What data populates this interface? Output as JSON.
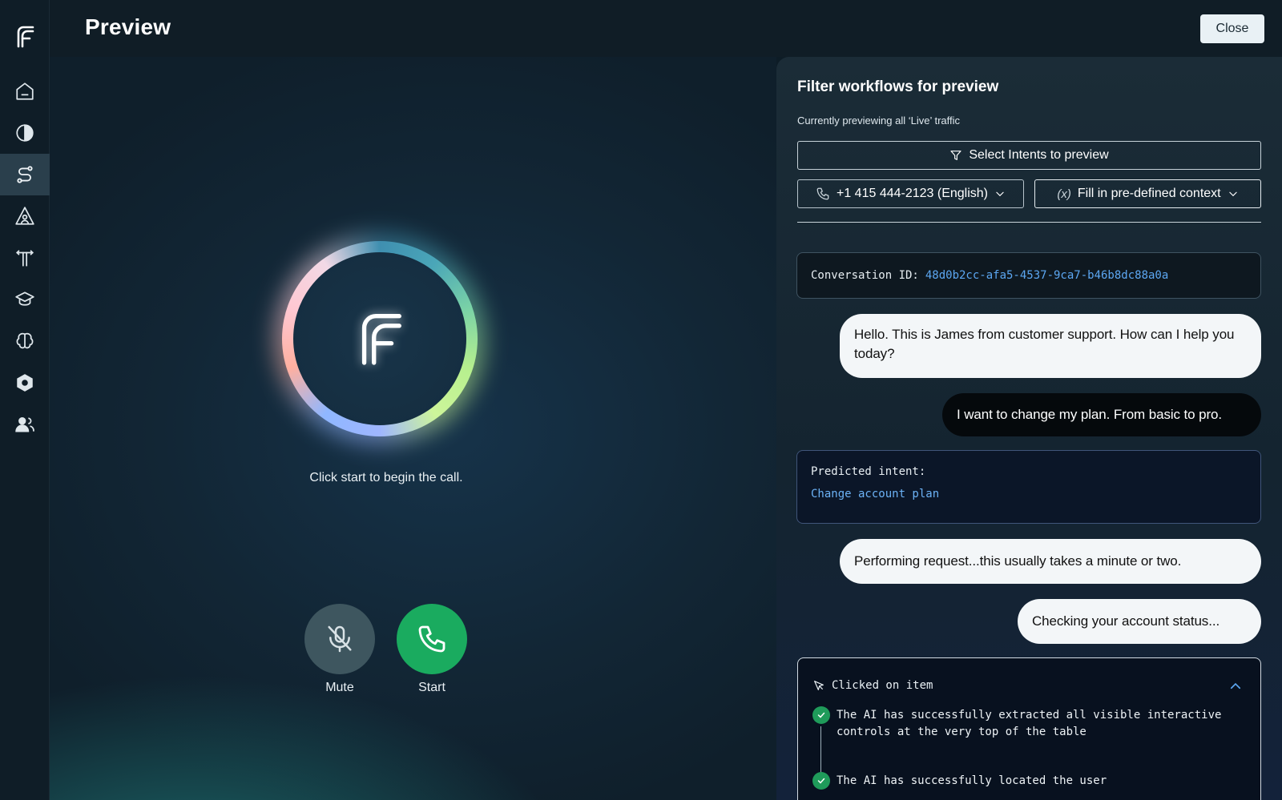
{
  "header": {
    "title": "Preview",
    "close_label": "Close"
  },
  "sidebar": {
    "items": [
      {
        "icon": "home-icon"
      },
      {
        "icon": "analytics-icon"
      },
      {
        "icon": "workflows-icon",
        "active": true
      },
      {
        "icon": "agent-icon"
      },
      {
        "icon": "routing-icon"
      },
      {
        "icon": "training-icon"
      },
      {
        "icon": "knowledge-icon"
      },
      {
        "icon": "settings-icon"
      },
      {
        "icon": "users-icon"
      }
    ]
  },
  "call": {
    "hint": "Click start to begin the call.",
    "mute_label": "Mute",
    "start_label": "Start"
  },
  "panel": {
    "title": "Filter workflows for preview",
    "subtitle": "Currently previewing all ‘Live’ traffic",
    "select_intents_label": "Select Intents to preview",
    "phone_dropdown": "+1 415 444-2123 (English)",
    "context_dropdown": "Fill in pre-defined context",
    "conversation_id_label": "Conversation ID:",
    "conversation_id": "48d0b2cc-afa5-4537-9ca7-b46b8dc88a0a",
    "messages": [
      {
        "role": "ai",
        "text": "Hello. This is James from customer support. How can I help you today?"
      },
      {
        "role": "user",
        "text": "I want to change my plan. From basic to pro."
      },
      {
        "role": "ai",
        "text": "Performing request...this usually takes a minute or two."
      },
      {
        "role": "ai",
        "text": "Checking your account status..."
      }
    ],
    "predicted_intent_label": "Predicted intent:",
    "predicted_intent": "Change account plan",
    "action": {
      "title": "Clicked on item",
      "steps": [
        "The AI has successfully extracted all visible interactive controls at the very top of the table",
        "The AI has successfully located the user"
      ]
    }
  },
  "colors": {
    "accent_green": "#1aab5f",
    "link_blue": "#5ca7f2",
    "success_green": "#1f9b5a"
  }
}
